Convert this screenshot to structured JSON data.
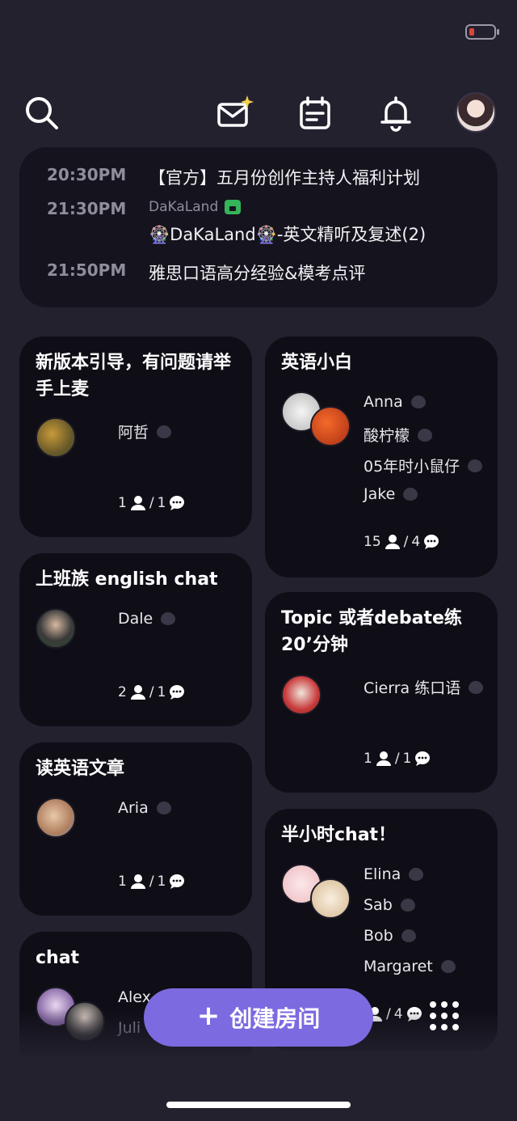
{
  "schedule": [
    {
      "time": "20:30PM",
      "title": "【官方】五月份创作主持人福利计划"
    },
    {
      "time": "21:30PM",
      "host": "DaKaLand",
      "title": "🎡DaKaLand🎡-英文精听及复述(2)"
    },
    {
      "time": "21:50PM",
      "title": "雅思口语高分经验&模考点评"
    }
  ],
  "rooms": [
    {
      "title": "新版本引导，有问题请举手上麦",
      "members": [
        "阿哲"
      ],
      "people": "1",
      "speakers": "1"
    },
    {
      "title": "英语小白",
      "members": [
        "Anna",
        "酸柠檬",
        "05年时小鼠仔",
        "Jake"
      ],
      "people": "15",
      "speakers": "4"
    },
    {
      "title": "上班族 english chat",
      "members": [
        "Dale"
      ],
      "people": "2",
      "speakers": "1"
    },
    {
      "title": "Topic 或者debate练20’分钟",
      "members": [
        "Cierra 练口语"
      ],
      "people": "1",
      "speakers": "1"
    },
    {
      "title": "读英语文章",
      "members": [
        "Aria"
      ],
      "people": "1",
      "speakers": "1"
    },
    {
      "title": "半小时chat！",
      "members": [
        "Elina",
        "Sab",
        "Bob",
        "Margaret"
      ],
      "people": "",
      "speakers": "4"
    },
    {
      "title": "chat",
      "members": [
        "Alex",
        "Juli"
      ],
      "people": "",
      "speakers": ""
    }
  ],
  "create_button": "创建房间",
  "icons": {
    "search": "search-icon",
    "mail": "mail-sparkle-icon",
    "calendar": "calendar-icon",
    "bell": "bell-icon",
    "grid": "grid-icon"
  },
  "colors": {
    "accent": "#7c6ae0",
    "background": "#24212f",
    "card": "#0f0e16"
  }
}
